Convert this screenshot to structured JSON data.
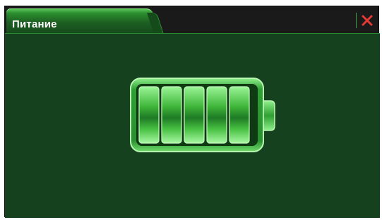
{
  "window": {
    "title": "Питание"
  },
  "titlebar": {
    "close_icon": "close-icon"
  },
  "battery": {
    "icon": "battery-icon",
    "charge_level": 1.0,
    "segments_filled": 5,
    "segments_total": 5
  },
  "colors": {
    "background": "#15411f",
    "accent": "#3fb83a",
    "close": "#e53935"
  }
}
